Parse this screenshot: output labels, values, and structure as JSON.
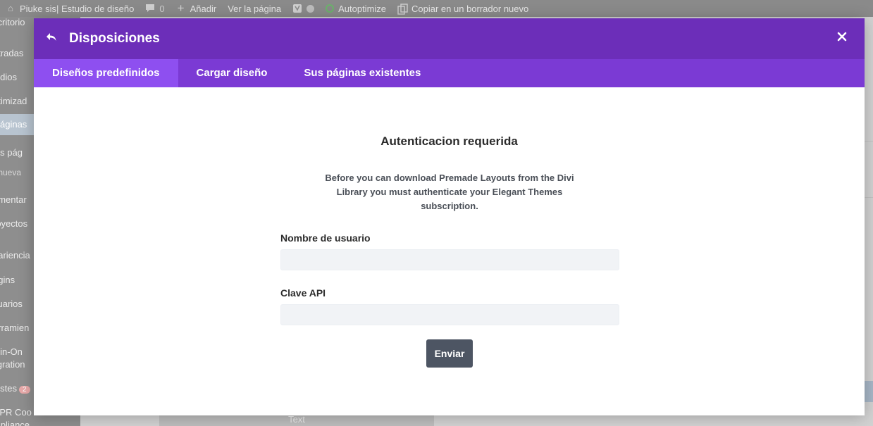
{
  "adminbar": {
    "site_name": "Piuke sis| Estudio de diseño",
    "comments_count": "0",
    "add_new": "Añadir",
    "view_page": "Ver la página",
    "autoptimize": "Autoptimize",
    "copy_draft": "Copiar en un borrador nuevo"
  },
  "adminmenu": {
    "items": [
      {
        "label": "scritorio"
      },
      {
        "label": "ntradas"
      },
      {
        "label": "ledios"
      },
      {
        "label": "ptimizad"
      },
      {
        "label": "áginas"
      },
      {
        "label": "las pág"
      },
      {
        "label": "r nueva"
      },
      {
        "label": "omentar"
      },
      {
        "label": "royectos"
      },
      {
        "label": "pariencia"
      },
      {
        "label": "ugins"
      },
      {
        "label": "suarios"
      },
      {
        "label": "erramien"
      },
      {
        "label": "ll-in-On"
      },
      {
        "label": "ligration"
      },
      {
        "label": "justes"
      },
      {
        "label": "DPR Coo"
      },
      {
        "label": "mpliance"
      }
    ],
    "settings_badge": "2"
  },
  "background": {
    "strip_text": "Text"
  },
  "modal": {
    "title": "Disposiciones",
    "tabs": [
      {
        "label": "Diseños predefinidos",
        "active": true
      },
      {
        "label": "Cargar diseño",
        "active": false
      },
      {
        "label": "Sus páginas existentes",
        "active": false
      }
    ],
    "auth": {
      "title": "Autenticacion requerida",
      "description": "Before you can download Premade Layouts from the Divi Library you must authenticate your Elegant Themes subscription.",
      "username_label": "Nombre de usuario",
      "username_value": "",
      "api_key_label": "Clave API",
      "api_key_value": "",
      "submit_label": "Enviar"
    }
  },
  "colors": {
    "header": "#6c2eb9",
    "tabs_bar": "#7b3ad4",
    "active_tab": "#8e4ff0",
    "submit_button": "#4d5563"
  }
}
